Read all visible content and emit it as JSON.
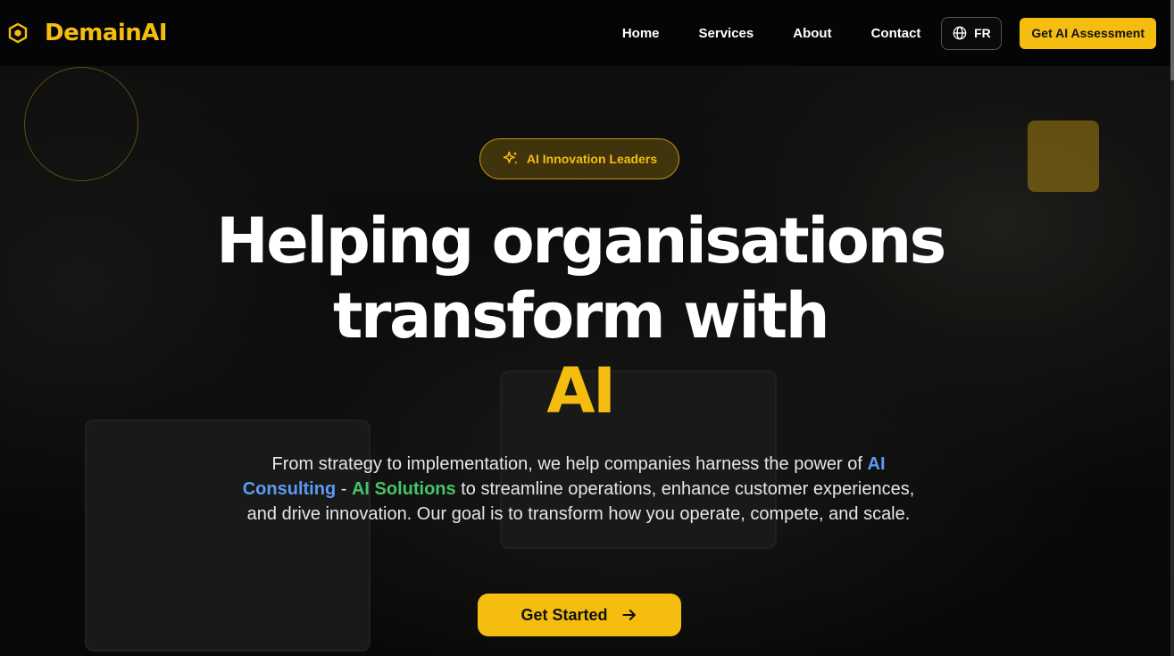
{
  "brand": {
    "name": "DemainAI",
    "logo_icon": "hexagon-icon",
    "accent": "#f5bd0f"
  },
  "nav": {
    "items": [
      {
        "label": "Home"
      },
      {
        "label": "Services"
      },
      {
        "label": "About"
      },
      {
        "label": "Contact"
      }
    ],
    "language": {
      "label": "FR",
      "icon": "globe-icon"
    },
    "cta_label": "Get AI Assessment"
  },
  "hero": {
    "badge": {
      "label": "AI Innovation Leaders",
      "icon": "sparkles-icon"
    },
    "headline": {
      "line1": "Helping organisations",
      "line2": "transform with",
      "accent": "AI"
    },
    "description": {
      "part1": "From strategy to implementation, we help companies harness the power of",
      "highlight1": "AI Consulting",
      "separator": "-",
      "highlight2": "AI Solutions",
      "part2": "to streamline operations, enhance customer experiences, and drive innovation. Our goal is to transform how you operate, compete, and scale.",
      "highlight1_color": "#5b9bf5",
      "highlight2_color": "#45c46a"
    },
    "cta": {
      "label": "Get Started",
      "icon": "arrow-right-icon"
    }
  }
}
